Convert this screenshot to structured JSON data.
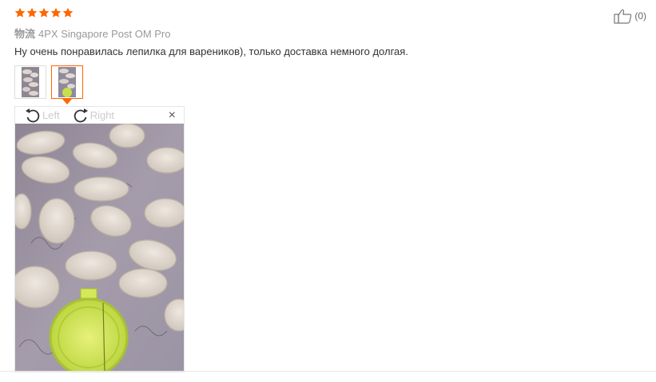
{
  "review": {
    "rating": 5,
    "rating_color": "#f60",
    "logistics_label": "物流",
    "logistics_value": "4PX Singapore Post OM Pro",
    "text": "Ну очень понравилась лепилка для вареников), только доставка немного долгая.",
    "likes_count": "(0)",
    "likes_icon": "thumbs-up-icon"
  },
  "thumbnails": [
    {
      "name": "photo-1",
      "active": false
    },
    {
      "name": "photo-2",
      "active": true
    }
  ],
  "viewer": {
    "rotate_left_label": "Left",
    "rotate_right_label": "Right",
    "close_label": "×"
  }
}
